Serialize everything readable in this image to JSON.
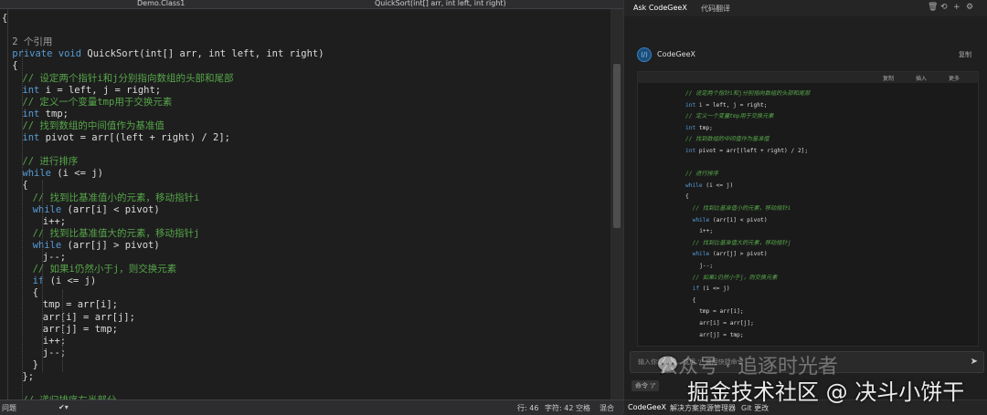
{
  "editor": {
    "nav_tab1": "Demo.Class1",
    "nav_tab2": "QuickSort(int[] arr, int left, int right)",
    "lines": [
      {
        "indent": 0,
        "text": "{",
        "kind": "tx"
      },
      {
        "indent": 0,
        "text": "",
        "kind": "tx"
      },
      {
        "indent": 2,
        "text": "2 个引用",
        "kind": "ref"
      },
      {
        "indent": 2,
        "kw": "private void",
        "text": " QuickSort(int[] arr, int left, int right)",
        "kind": "mix"
      },
      {
        "indent": 2,
        "text": "{",
        "kind": "tx"
      },
      {
        "indent": 4,
        "text": "// 设定两个指针i和j分别指向数组的头部和尾部",
        "kind": "cm"
      },
      {
        "indent": 4,
        "kw": "int",
        "text": " i = left, j = right;",
        "kind": "mix"
      },
      {
        "indent": 4,
        "text": "// 定义一个变量tmp用于交换元素",
        "kind": "cm"
      },
      {
        "indent": 4,
        "kw": "int",
        "text": " tmp;",
        "kind": "mix"
      },
      {
        "indent": 4,
        "text": "// 找到数组的中间值作为基准值",
        "kind": "cm"
      },
      {
        "indent": 4,
        "kw": "int",
        "text": " pivot = arr[(left + right) / 2];",
        "kind": "mix"
      },
      {
        "indent": 4,
        "text": "",
        "kind": "tx"
      },
      {
        "indent": 4,
        "text": "// 进行排序",
        "kind": "cm"
      },
      {
        "indent": 4,
        "kw": "while",
        "text": " (i <= j)",
        "kind": "mix"
      },
      {
        "indent": 4,
        "text": "{",
        "kind": "tx"
      },
      {
        "indent": 6,
        "text": "// 找到比基准值小的元素，移动指针i",
        "kind": "cm"
      },
      {
        "indent": 6,
        "kw": "while",
        "text": " (arr[i] < pivot)",
        "kind": "mix"
      },
      {
        "indent": 8,
        "text": "i++;",
        "kind": "tx"
      },
      {
        "indent": 6,
        "text": "// 找到比基准值大的元素，移动指针j",
        "kind": "cm"
      },
      {
        "indent": 6,
        "kw": "while",
        "text": " (arr[j] > pivot)",
        "kind": "mix"
      },
      {
        "indent": 8,
        "text": "j--;",
        "kind": "tx"
      },
      {
        "indent": 6,
        "text": "// 如果i仍然小于j，则交换元素",
        "kind": "cm"
      },
      {
        "indent": 6,
        "kw": "if",
        "text": " (i <= j)",
        "kind": "mix"
      },
      {
        "indent": 6,
        "text": "{",
        "kind": "tx"
      },
      {
        "indent": 8,
        "text": "tmp = arr[i];",
        "kind": "tx"
      },
      {
        "indent": 8,
        "text": "arr[i] = arr[j];",
        "kind": "tx"
      },
      {
        "indent": 8,
        "text": "arr[j] = tmp;",
        "kind": "tx"
      },
      {
        "indent": 8,
        "text": "i++;",
        "kind": "tx"
      },
      {
        "indent": 8,
        "text": "j--;",
        "kind": "tx"
      },
      {
        "indent": 6,
        "text": "}",
        "kind": "tx"
      },
      {
        "indent": 4,
        "text": "};",
        "kind": "tx"
      },
      {
        "indent": 4,
        "text": "",
        "kind": "tx"
      },
      {
        "indent": 4,
        "text": "// 递归排序左半部分",
        "kind": "cm"
      }
    ]
  },
  "status": {
    "left": "问题",
    "line": "行: 46",
    "char": "字符: 42",
    "space": "空格",
    "mixed": "混合"
  },
  "panel": {
    "tab_ask": "Ask CodeGeeX",
    "tab_translate": "代码翻译",
    "assistant_name": "CodeGeeX",
    "copy_label": "复制",
    "box_copy": "复制",
    "box_insert": "插入",
    "box_more": "更多",
    "input_placeholder": "输入你的问题，或用 '/' 调用快捷命令",
    "cmd_label": "命令 '/'",
    "bottom_tab1": "CodeGeeX",
    "bottom_tab2": "解决方案资源管理器",
    "bottom_tab3": "Git 更改",
    "code_lines": [
      {
        "indent": 0,
        "text": "// 设定两个指针i和j分别指向数组的头部和尾部",
        "kind": "cm"
      },
      {
        "indent": 0,
        "kw": "int",
        "text": " i = left, j = right;",
        "kind": "mix"
      },
      {
        "indent": 0,
        "text": "// 定义一个变量tmp用于交换元素",
        "kind": "cm"
      },
      {
        "indent": 0,
        "kw": "int",
        "text": " tmp;",
        "kind": "mix"
      },
      {
        "indent": 0,
        "text": "// 找到数组的中间值作为基准值",
        "kind": "cm"
      },
      {
        "indent": 0,
        "kw": "int",
        "text": " pivot = arr[(left + right) / 2];",
        "kind": "mix"
      },
      {
        "indent": 0,
        "text": "",
        "kind": "tx"
      },
      {
        "indent": 0,
        "text": "// 进行排序",
        "kind": "cm"
      },
      {
        "indent": 0,
        "kw": "while",
        "text": " (i <= j)",
        "kind": "mix"
      },
      {
        "indent": 0,
        "text": "{",
        "kind": "tx"
      },
      {
        "indent": 2,
        "text": "// 找到比基准值小的元素，移动指针i",
        "kind": "cm"
      },
      {
        "indent": 2,
        "kw": "while",
        "text": " (arr[i] < pivot)",
        "kind": "mix"
      },
      {
        "indent": 4,
        "text": "i++;",
        "kind": "tx"
      },
      {
        "indent": 2,
        "text": "// 找到比基准值大的元素，移动指针j",
        "kind": "cm"
      },
      {
        "indent": 2,
        "kw": "while",
        "text": " (arr[j] > pivot)",
        "kind": "mix"
      },
      {
        "indent": 4,
        "text": "j--;",
        "kind": "tx"
      },
      {
        "indent": 2,
        "text": "// 如果i仍然小于j，则交换元素",
        "kind": "cm"
      },
      {
        "indent": 2,
        "kw": "if",
        "text": " (i <= j)",
        "kind": "mix"
      },
      {
        "indent": 2,
        "text": "{",
        "kind": "tx"
      },
      {
        "indent": 4,
        "text": "tmp = arr[i];",
        "kind": "tx"
      },
      {
        "indent": 4,
        "text": "arr[i] = arr[j];",
        "kind": "tx"
      },
      {
        "indent": 4,
        "text": "arr[j] = tmp;",
        "kind": "tx"
      }
    ]
  },
  "watermark": {
    "line1": "公众号 · 追逐时光者",
    "line2": "掘金技术社区 @ 决斗小饼干"
  }
}
